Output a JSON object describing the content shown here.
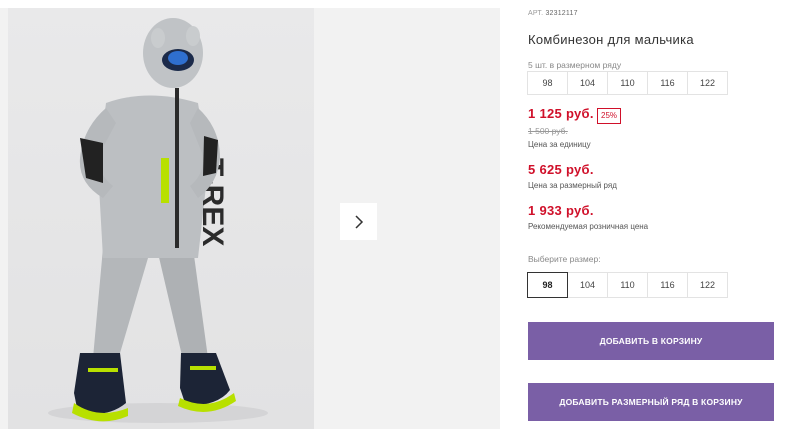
{
  "product": {
    "article_label": "АРТ.",
    "article_number": "32312117",
    "title": "Комбинезон для мальчика",
    "photo_alt": "Мальчик в сером комбинезоне с капюшоном"
  },
  "pack": {
    "note": "5 шт. в размерном ряду",
    "sizes": [
      "98",
      "104",
      "110",
      "116",
      "122"
    ]
  },
  "prices": {
    "unit_price": "1 125 руб.",
    "discount": "25%",
    "old_price": "1 500 руб.",
    "unit_caption": "Цена за единицу",
    "pack_price": "5 625 руб.",
    "pack_caption": "Цена за размерный ряд",
    "retail_price": "1 933 руб.",
    "retail_caption": "Рекомендуемая розничная цена"
  },
  "size_picker": {
    "label": "Выберите размер:",
    "options": [
      "98",
      "104",
      "110",
      "116",
      "122"
    ],
    "selected": "98"
  },
  "buttons": {
    "add_to_cart": "ДОБАВИТЬ В КОРЗИНУ",
    "add_pack_to_cart": "ДОБАВИТЬ РАЗМЕРНЫЙ РЯД В КОРЗИНУ"
  },
  "colors": {
    "price_red": "#d0102a",
    "button_purple": "#7a5fa6",
    "suit_grey": "#b9bcbf",
    "accent_lime": "#b8e000"
  },
  "icons": {
    "gallery_next": "chevron-right-icon"
  }
}
